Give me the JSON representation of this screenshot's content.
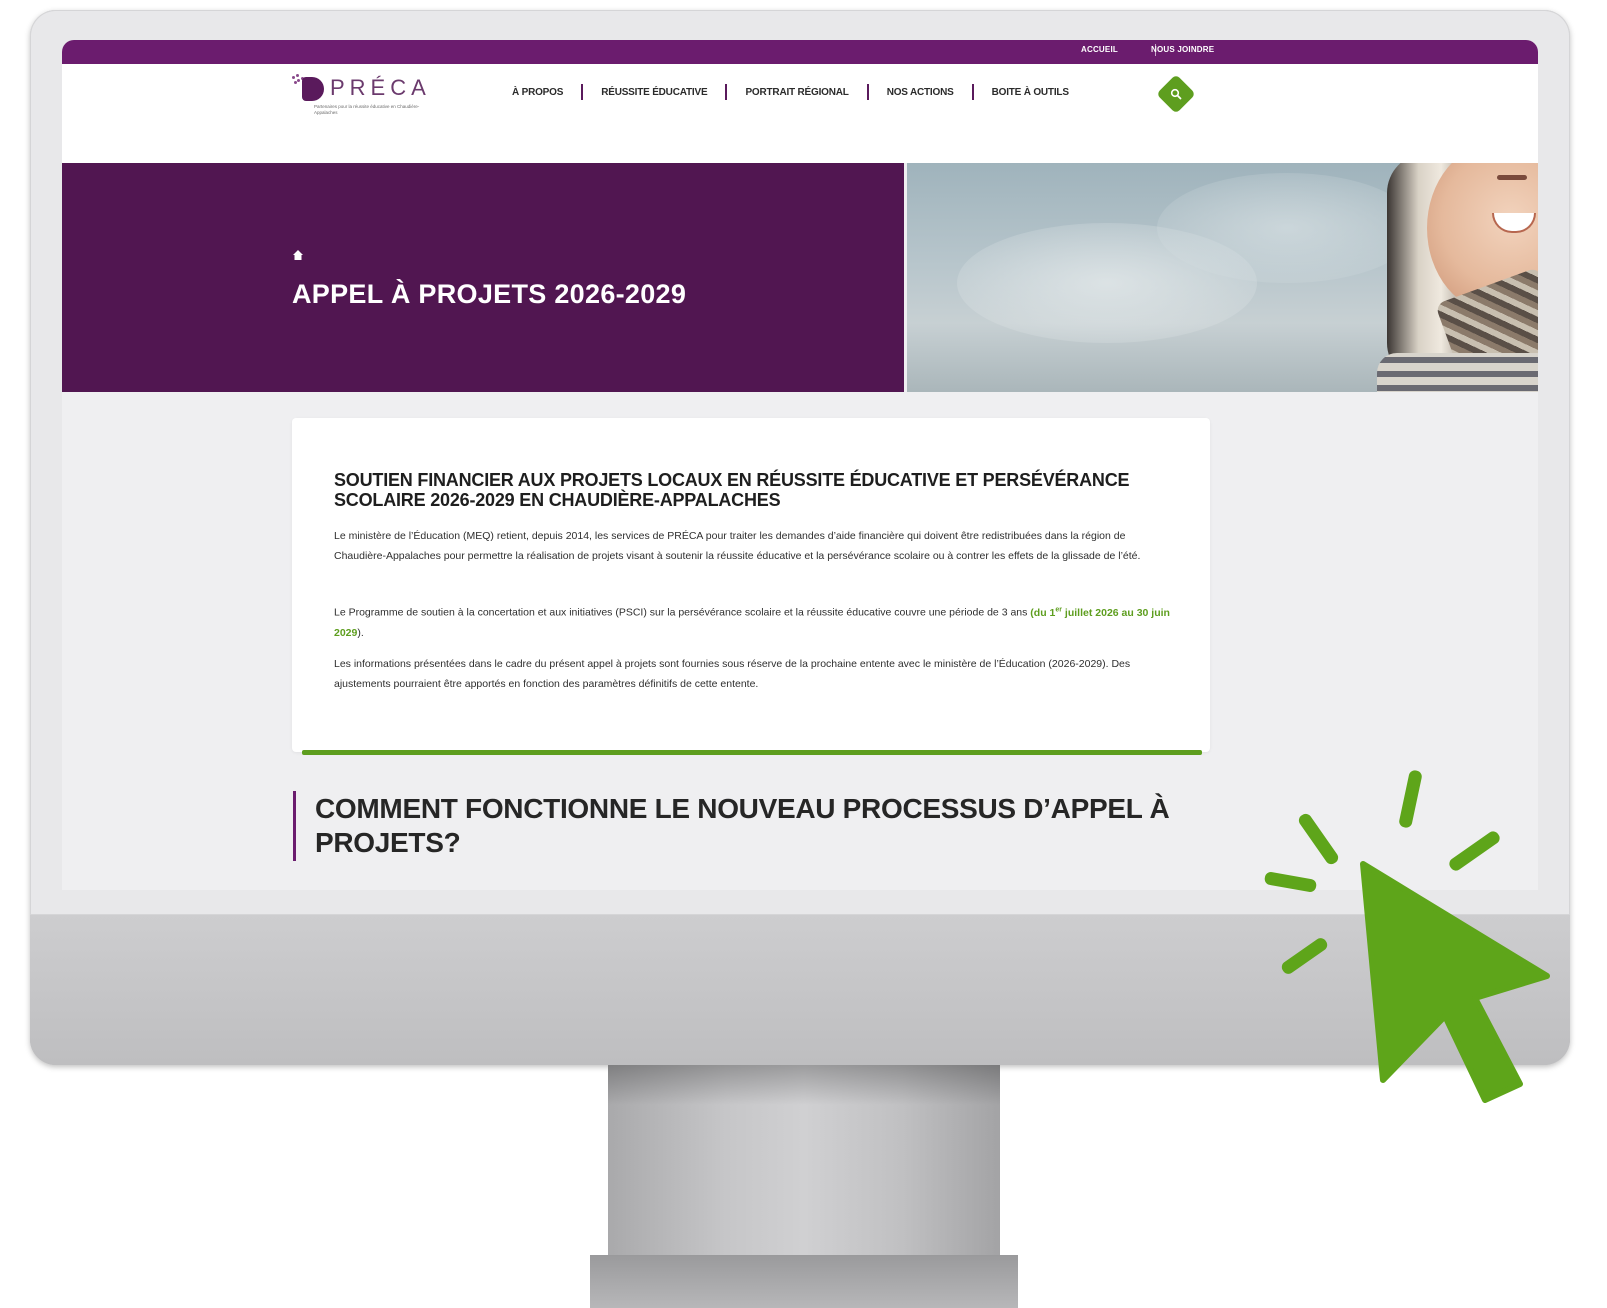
{
  "top_links": {
    "home": "ACCUEIL",
    "contact": "NOUS JOINDRE"
  },
  "logo": {
    "name": "PRÉCA",
    "tagline": "Partenaires pour la réussite éducative en Chaudière-Appalaches"
  },
  "nav": [
    "À PROPOS",
    "RÉUSSITE ÉDUCATIVE",
    "PORTRAIT RÉGIONAL",
    "NOS ACTIONS",
    "BOITE À OUTILS"
  ],
  "hero": {
    "title": "APPEL À PROJETS 2026-2029"
  },
  "card": {
    "title": "SOUTIEN FINANCIER AUX PROJETS LOCAUX EN RÉUSSITE ÉDUCATIVE ET PERSÉVÉRANCE SCOLAIRE 2026-2029 EN CHAUDIÈRE-APPALACHES",
    "p1": "Le ministère de l’Éducation (MEQ) retient, depuis 2014, les services de PRÉCA pour traiter les demandes d’aide financière qui doivent être redistribuées dans la région de Chaudière-Appalaches pour permettre la réalisation de projets visant à soutenir la réussite éducative et la persévérance scolaire ou à contrer les effets de la glissade de l’été.",
    "p2_text": "Le Programme de soutien à la concertation et aux initiatives (PSCI) sur la persévérance scolaire et la réussite éducative couvre une période de 3 ans",
    "p2_highlight_open": "(du 1",
    "p2_highlight_sup": "er",
    "p2_highlight_rest": " juillet 2026 au 30 juin 2029",
    "p2_close": ").",
    "p3": "Les informations présentées dans le cadre du présent appel à projets sont fournies sous réserve de la prochaine entente avec le ministère de l’Éducation (2026-2029). Des ajustements pourraient être apportés en fonction des paramètres définitifs de cette entente."
  },
  "section": {
    "title": "COMMENT FONCTIONNE LE NOUVEAU PROCESSUS D’APPEL À PROJETS?"
  },
  "colors": {
    "purple": "#511651",
    "purple_bar": "#6b1c6e",
    "green": "#5e9e1f",
    "cursor_green": "#5ea51a"
  },
  "icons": [
    "home-icon",
    "search-icon",
    "cursor-click-icon"
  ]
}
